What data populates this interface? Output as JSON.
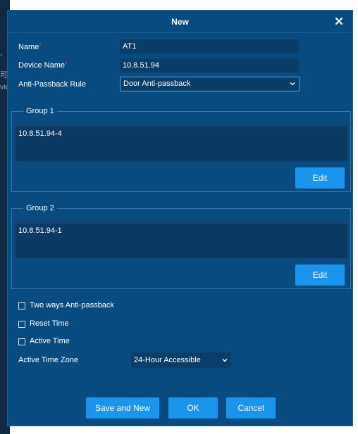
{
  "background": {
    "glyphs": [
      "-",
      "可",
      "vic"
    ]
  },
  "dialog": {
    "title": "New",
    "close_icon": "close-icon",
    "colors": {
      "panel": "#084b80",
      "field": "#0a3e6a",
      "button": "#1a95ee",
      "required": "#e0484c"
    }
  },
  "form": {
    "name_label": "Name",
    "name_required": "*",
    "name_value": "AT1",
    "device_label": "Device Name",
    "device_required": "*",
    "device_value": "10.8.51.94",
    "rule_label": "Anti-Passback Rule",
    "rule_value": "Door Anti-passback"
  },
  "groups": [
    {
      "legend": "Group 1",
      "items": [
        "10.8.51.94-4"
      ],
      "edit_label": "Edit"
    },
    {
      "legend": "Group 2",
      "items": [
        "10.8.51.94-1"
      ],
      "edit_label": "Edit"
    }
  ],
  "options": {
    "two_ways": {
      "label": "Two ways Anti-passback",
      "checked": false
    },
    "reset_time": {
      "label": "Reset Time",
      "checked": false
    },
    "active_time": {
      "label": "Active Time",
      "checked": false
    }
  },
  "timezone": {
    "label": "Active Time Zone",
    "value": "24-Hour Accessible"
  },
  "footer": {
    "save_new_label": "Save and New",
    "ok_label": "OK",
    "cancel_label": "Cancel"
  }
}
